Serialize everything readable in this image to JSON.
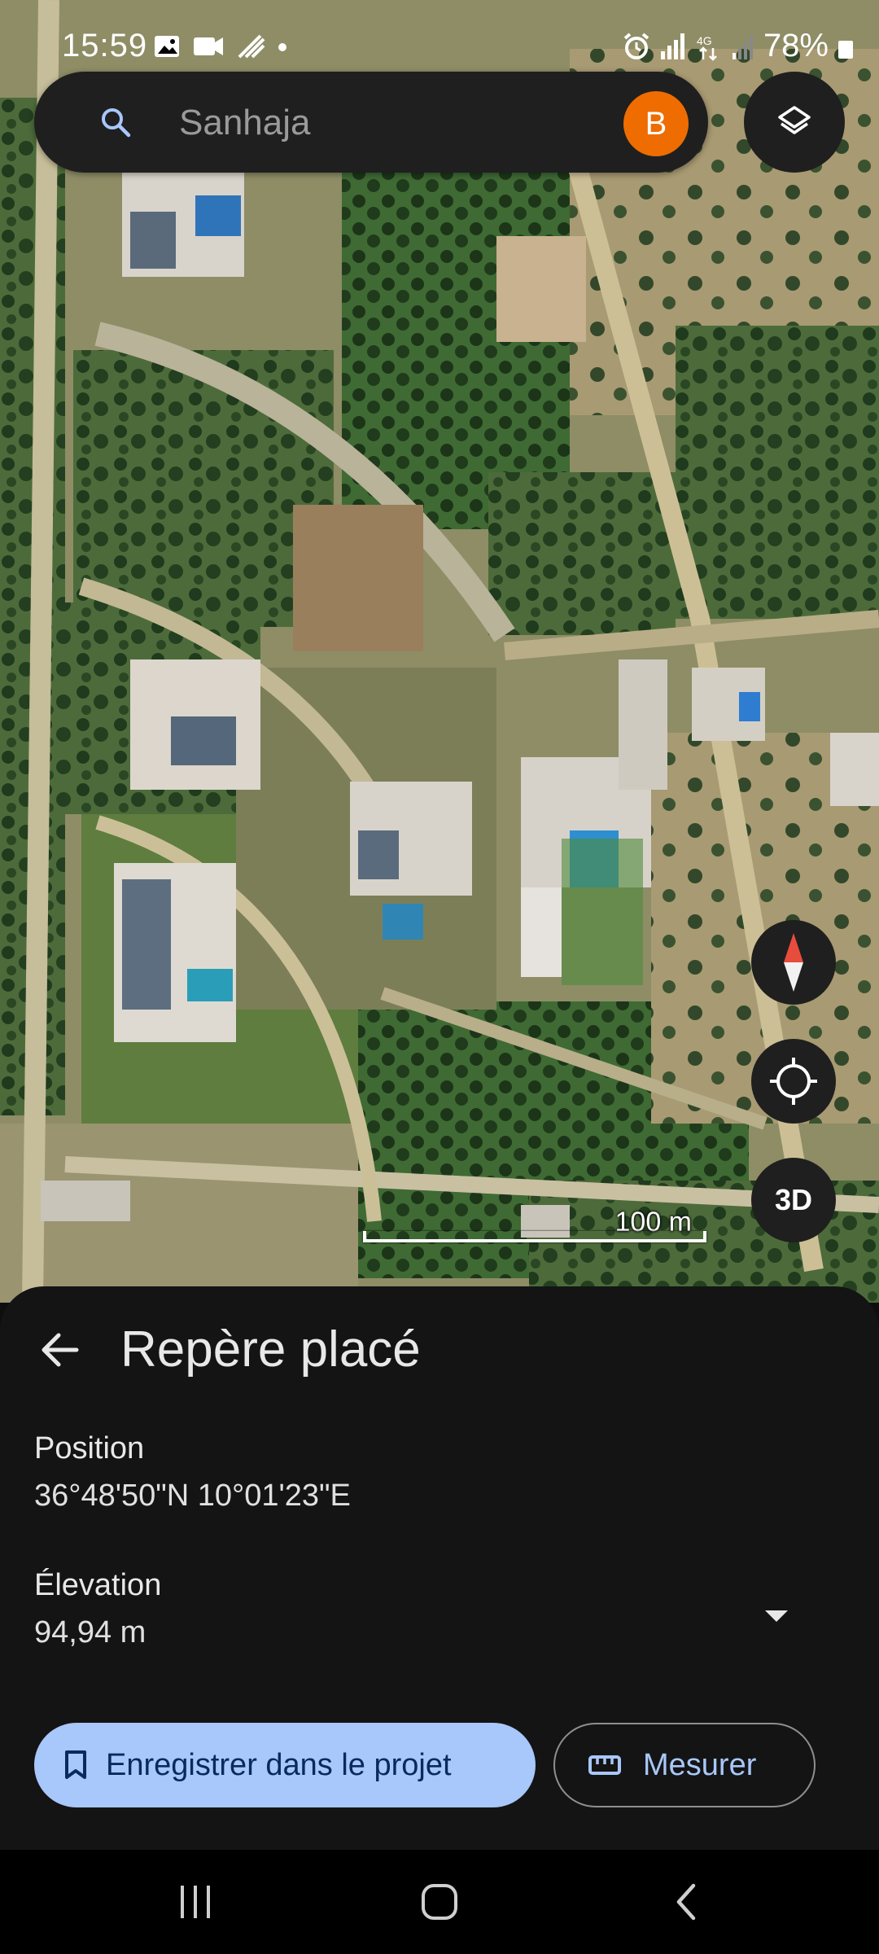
{
  "status_bar": {
    "time": "15:59",
    "battery_percent": "78%"
  },
  "search": {
    "text": "Sanhaja",
    "avatar_letter": "B"
  },
  "map": {
    "scale_label": "100 m",
    "three_d_label": "3D"
  },
  "sheet": {
    "title": "Repère placé",
    "position_label": "Position",
    "position_value": "36°48'50\"N 10°01'23\"E",
    "elevation_label": "Élevation",
    "elevation_value": "94,94 m",
    "save_button": "Enregistrer dans le projet",
    "measure_button": "Mesurer"
  },
  "colors": {
    "avatar": "#ef6c00",
    "primary_button": "#a8c7fa",
    "sheet_bg": "#141414"
  }
}
